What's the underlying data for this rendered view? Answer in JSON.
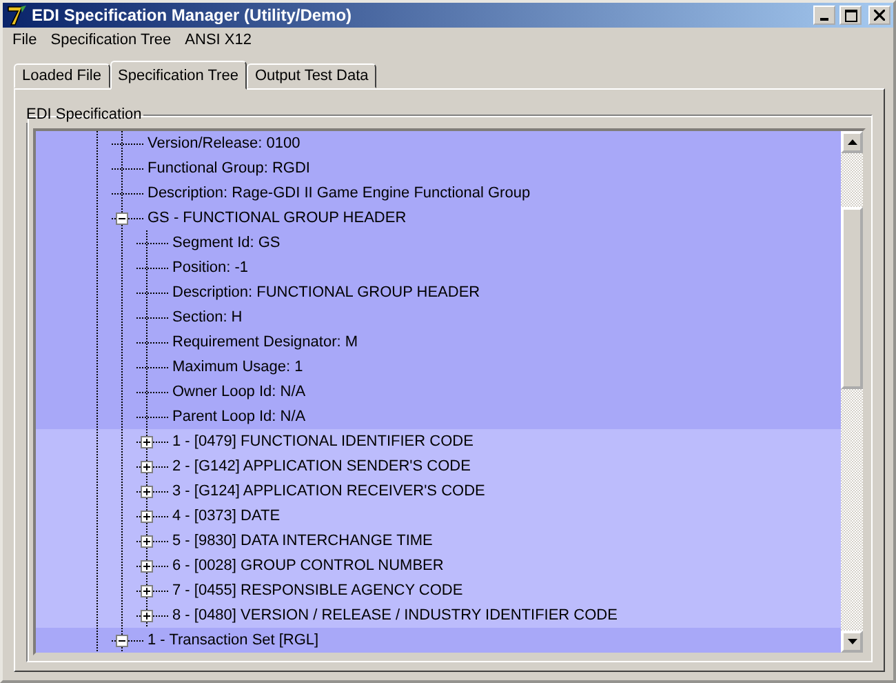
{
  "window": {
    "title": "EDI Specification Manager (Utility/Demo)"
  },
  "menu": [
    "File",
    "Specification Tree",
    "ANSI X12"
  ],
  "tabs": [
    {
      "label": "Loaded File",
      "selected": false
    },
    {
      "label": "Specification Tree",
      "selected": true
    },
    {
      "label": "Output Test Data",
      "selected": false
    }
  ],
  "group": {
    "title": "EDI Specification"
  },
  "tree": [
    {
      "label": "Version/Release: 0100",
      "highlighted": true
    },
    {
      "label": "Functional Group: RGDI",
      "highlighted": true
    },
    {
      "label": "Description: Rage-GDI II Game Engine Functional Group",
      "highlighted": true
    },
    {
      "label": "GS - FUNCTIONAL GROUP HEADER",
      "highlighted": true,
      "expanded": true,
      "children": [
        {
          "label": "Segment Id: GS",
          "highlighted": true
        },
        {
          "label": "Position: -1",
          "highlighted": true
        },
        {
          "label": "Description: FUNCTIONAL GROUP HEADER",
          "highlighted": true
        },
        {
          "label": "Section: H",
          "highlighted": true
        },
        {
          "label": "Requirement Designator: M",
          "highlighted": true
        },
        {
          "label": "Maximum Usage: 1",
          "highlighted": true
        },
        {
          "label": "Owner Loop Id: N/A",
          "highlighted": true
        },
        {
          "label": "Parent Loop Id: N/A",
          "highlighted": true
        },
        {
          "label": "1 - [0479] FUNCTIONAL IDENTIFIER CODE",
          "highlighted": false,
          "expanded": false
        },
        {
          "label": "2 - [G142] APPLICATION SENDER'S CODE",
          "highlighted": false,
          "expanded": false
        },
        {
          "label": "3 - [G124] APPLICATION RECEIVER'S CODE",
          "highlighted": false,
          "expanded": false
        },
        {
          "label": "4 - [0373] DATE",
          "highlighted": false,
          "expanded": false
        },
        {
          "label": "5 - [9830] DATA INTERCHANGE TIME",
          "highlighted": false,
          "expanded": false
        },
        {
          "label": "6 - [0028] GROUP CONTROL NUMBER",
          "highlighted": false,
          "expanded": false
        },
        {
          "label": "7 - [0455] RESPONSIBLE AGENCY CODE",
          "highlighted": false,
          "expanded": false
        },
        {
          "label": "8 - [0480] VERSION / RELEASE / INDUSTRY IDENTIFIER CODE",
          "highlighted": false,
          "expanded": false
        }
      ]
    },
    {
      "label": "1 - Transaction Set [RGL]",
      "highlighted": true,
      "expanded": true
    }
  ]
}
